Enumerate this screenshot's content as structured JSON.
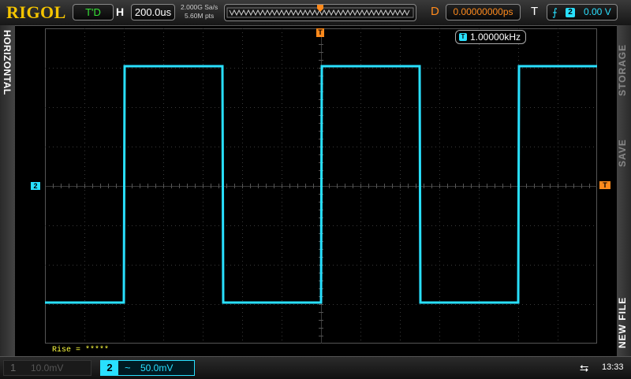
{
  "brand": "RIGOL",
  "run_state": "T'D",
  "horizontal": {
    "label": "H",
    "timebase": "200.0us",
    "sample_rate": "2.000G Sa/s",
    "memory_depth": "5.60M pts"
  },
  "delay": {
    "label": "D",
    "value": "0.00000000ps"
  },
  "trigger": {
    "label": "T",
    "slope_icon": "rising-edge-icon",
    "source": "2",
    "level": "0.00 V",
    "marker": "T"
  },
  "side_tabs": {
    "left": "HORIZONTAL",
    "right_active": "NEW FILE",
    "right_save": "SAVE",
    "right_storage": "STORAGE"
  },
  "frequency_counter": {
    "icon": "T",
    "value": "1.00000kHz"
  },
  "channel_marker": "2",
  "measurement": "Rise = *****",
  "channels": [
    {
      "num": "1",
      "scale": "10.0mV",
      "active": false
    },
    {
      "num": "2",
      "coupling": "~",
      "scale": "50.0mV",
      "active": true
    }
  ],
  "clock": "13:33",
  "colors": {
    "trace": "#29e0ff",
    "accent": "#ff8a1c",
    "brand": "#f4c400",
    "grid": "#3a3a3a"
  }
}
